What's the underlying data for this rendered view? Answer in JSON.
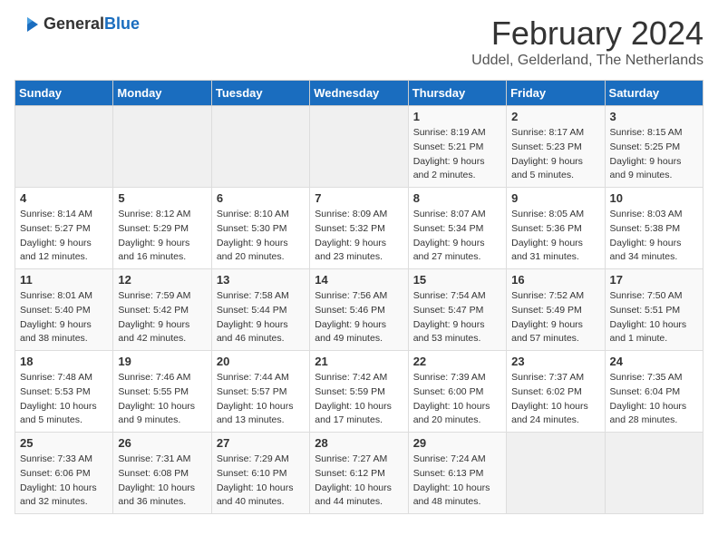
{
  "header": {
    "logo_general": "General",
    "logo_blue": "Blue",
    "month": "February 2024",
    "location": "Uddel, Gelderland, The Netherlands"
  },
  "days_of_week": [
    "Sunday",
    "Monday",
    "Tuesday",
    "Wednesday",
    "Thursday",
    "Friday",
    "Saturday"
  ],
  "weeks": [
    [
      {
        "day": "",
        "info": ""
      },
      {
        "day": "",
        "info": ""
      },
      {
        "day": "",
        "info": ""
      },
      {
        "day": "",
        "info": ""
      },
      {
        "day": "1",
        "info": "Sunrise: 8:19 AM\nSunset: 5:21 PM\nDaylight: 9 hours\nand 2 minutes."
      },
      {
        "day": "2",
        "info": "Sunrise: 8:17 AM\nSunset: 5:23 PM\nDaylight: 9 hours\nand 5 minutes."
      },
      {
        "day": "3",
        "info": "Sunrise: 8:15 AM\nSunset: 5:25 PM\nDaylight: 9 hours\nand 9 minutes."
      }
    ],
    [
      {
        "day": "4",
        "info": "Sunrise: 8:14 AM\nSunset: 5:27 PM\nDaylight: 9 hours\nand 12 minutes."
      },
      {
        "day": "5",
        "info": "Sunrise: 8:12 AM\nSunset: 5:29 PM\nDaylight: 9 hours\nand 16 minutes."
      },
      {
        "day": "6",
        "info": "Sunrise: 8:10 AM\nSunset: 5:30 PM\nDaylight: 9 hours\nand 20 minutes."
      },
      {
        "day": "7",
        "info": "Sunrise: 8:09 AM\nSunset: 5:32 PM\nDaylight: 9 hours\nand 23 minutes."
      },
      {
        "day": "8",
        "info": "Sunrise: 8:07 AM\nSunset: 5:34 PM\nDaylight: 9 hours\nand 27 minutes."
      },
      {
        "day": "9",
        "info": "Sunrise: 8:05 AM\nSunset: 5:36 PM\nDaylight: 9 hours\nand 31 minutes."
      },
      {
        "day": "10",
        "info": "Sunrise: 8:03 AM\nSunset: 5:38 PM\nDaylight: 9 hours\nand 34 minutes."
      }
    ],
    [
      {
        "day": "11",
        "info": "Sunrise: 8:01 AM\nSunset: 5:40 PM\nDaylight: 9 hours\nand 38 minutes."
      },
      {
        "day": "12",
        "info": "Sunrise: 7:59 AM\nSunset: 5:42 PM\nDaylight: 9 hours\nand 42 minutes."
      },
      {
        "day": "13",
        "info": "Sunrise: 7:58 AM\nSunset: 5:44 PM\nDaylight: 9 hours\nand 46 minutes."
      },
      {
        "day": "14",
        "info": "Sunrise: 7:56 AM\nSunset: 5:46 PM\nDaylight: 9 hours\nand 49 minutes."
      },
      {
        "day": "15",
        "info": "Sunrise: 7:54 AM\nSunset: 5:47 PM\nDaylight: 9 hours\nand 53 minutes."
      },
      {
        "day": "16",
        "info": "Sunrise: 7:52 AM\nSunset: 5:49 PM\nDaylight: 9 hours\nand 57 minutes."
      },
      {
        "day": "17",
        "info": "Sunrise: 7:50 AM\nSunset: 5:51 PM\nDaylight: 10 hours\nand 1 minute."
      }
    ],
    [
      {
        "day": "18",
        "info": "Sunrise: 7:48 AM\nSunset: 5:53 PM\nDaylight: 10 hours\nand 5 minutes."
      },
      {
        "day": "19",
        "info": "Sunrise: 7:46 AM\nSunset: 5:55 PM\nDaylight: 10 hours\nand 9 minutes."
      },
      {
        "day": "20",
        "info": "Sunrise: 7:44 AM\nSunset: 5:57 PM\nDaylight: 10 hours\nand 13 minutes."
      },
      {
        "day": "21",
        "info": "Sunrise: 7:42 AM\nSunset: 5:59 PM\nDaylight: 10 hours\nand 17 minutes."
      },
      {
        "day": "22",
        "info": "Sunrise: 7:39 AM\nSunset: 6:00 PM\nDaylight: 10 hours\nand 20 minutes."
      },
      {
        "day": "23",
        "info": "Sunrise: 7:37 AM\nSunset: 6:02 PM\nDaylight: 10 hours\nand 24 minutes."
      },
      {
        "day": "24",
        "info": "Sunrise: 7:35 AM\nSunset: 6:04 PM\nDaylight: 10 hours\nand 28 minutes."
      }
    ],
    [
      {
        "day": "25",
        "info": "Sunrise: 7:33 AM\nSunset: 6:06 PM\nDaylight: 10 hours\nand 32 minutes."
      },
      {
        "day": "26",
        "info": "Sunrise: 7:31 AM\nSunset: 6:08 PM\nDaylight: 10 hours\nand 36 minutes."
      },
      {
        "day": "27",
        "info": "Sunrise: 7:29 AM\nSunset: 6:10 PM\nDaylight: 10 hours\nand 40 minutes."
      },
      {
        "day": "28",
        "info": "Sunrise: 7:27 AM\nSunset: 6:12 PM\nDaylight: 10 hours\nand 44 minutes."
      },
      {
        "day": "29",
        "info": "Sunrise: 7:24 AM\nSunset: 6:13 PM\nDaylight: 10 hours\nand 48 minutes."
      },
      {
        "day": "",
        "info": ""
      },
      {
        "day": "",
        "info": ""
      }
    ]
  ]
}
